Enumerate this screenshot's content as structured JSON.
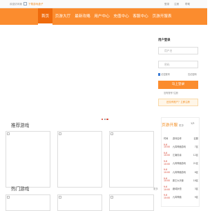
{
  "topbar": {
    "welcome": "欢迎访问我",
    "tip": "下载游戏盒子",
    "login": "登录",
    "register": "注册",
    "help": "帮助"
  },
  "nav": {
    "items": [
      {
        "label": "首页",
        "active": true
      },
      {
        "label": "页游大厅",
        "active": false
      },
      {
        "label": "最新攻略",
        "active": false
      },
      {
        "label": "用户中心",
        "active": false
      },
      {
        "label": "充值中心",
        "active": false
      },
      {
        "label": "客服中心",
        "active": false
      },
      {
        "label": "页游开服表",
        "active": false
      }
    ]
  },
  "banner": {
    "slides": 3,
    "active_slide": 1
  },
  "login_panel": {
    "title": "用户登录",
    "username_placeholder": "用户名",
    "password_placeholder": "密码",
    "remember": "记住账号",
    "forgot": "忘记密码",
    "login_button": "马上登录",
    "register_link": "没有账号?注册",
    "promo": "还没有账户？立即注册"
  },
  "recommended": {
    "title": "推荐游戏"
  },
  "hot": {
    "title": "热门游戏",
    "more": "更多"
  },
  "open_servers": {
    "title": "页游开服",
    "more": "更多",
    "page": "1/3",
    "headers": [
      "时间",
      "游戏名称",
      "区服"
    ],
    "rows": [
      {
        "date": "9-6",
        "time": "10:00",
        "game": "九霄神魔游戏",
        "server": "7区"
      },
      {
        "date": "9-6",
        "time": "10:00",
        "game": "江南情缘",
        "server": "12区"
      },
      {
        "date": "9-6",
        "time": "10:00",
        "game": "九霄神魔游戏",
        "server": "21区"
      },
      {
        "date": "9-6",
        "time": "10:00",
        "game": "九霄神魔游戏",
        "server": "6区"
      },
      {
        "date": "9-6",
        "time": "10:00",
        "game": "霸王大天使",
        "server": "18区"
      },
      {
        "date": "9-6",
        "time": "10:00",
        "game": "魔域永恒",
        "server": "3区"
      },
      {
        "date": "9-6",
        "time": "10:00",
        "game": "九霄神魔",
        "server": "9区"
      }
    ]
  },
  "colors": {
    "nav": "#fb8c2e",
    "nav_active": "#ef6a0c",
    "accent": "#f18a1c",
    "time_red": "#d43c2a"
  }
}
